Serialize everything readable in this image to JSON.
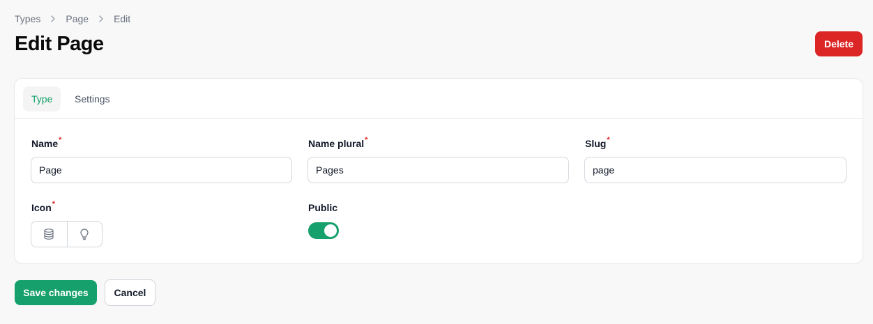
{
  "breadcrumb": {
    "items": [
      "Types",
      "Page",
      "Edit"
    ]
  },
  "header": {
    "title": "Edit Page",
    "delete_label": "Delete"
  },
  "tabs": [
    {
      "label": "Type",
      "active": true
    },
    {
      "label": "Settings",
      "active": false
    }
  ],
  "form": {
    "name": {
      "label": "Name",
      "required_mark": "*",
      "value": "Page"
    },
    "name_plural": {
      "label": "Name plural",
      "required_mark": "*",
      "value": "Pages"
    },
    "slug": {
      "label": "Slug",
      "required_mark": "*",
      "value": "page"
    },
    "icon": {
      "label": "Icon",
      "required_mark": "*",
      "options": [
        "database-icon",
        "lightbulb-icon"
      ]
    },
    "public": {
      "label": "Public",
      "enabled": true
    }
  },
  "actions": {
    "save_label": "Save changes",
    "cancel_label": "Cancel"
  },
  "colors": {
    "accent": "#16a06b",
    "danger": "#dc2626"
  }
}
